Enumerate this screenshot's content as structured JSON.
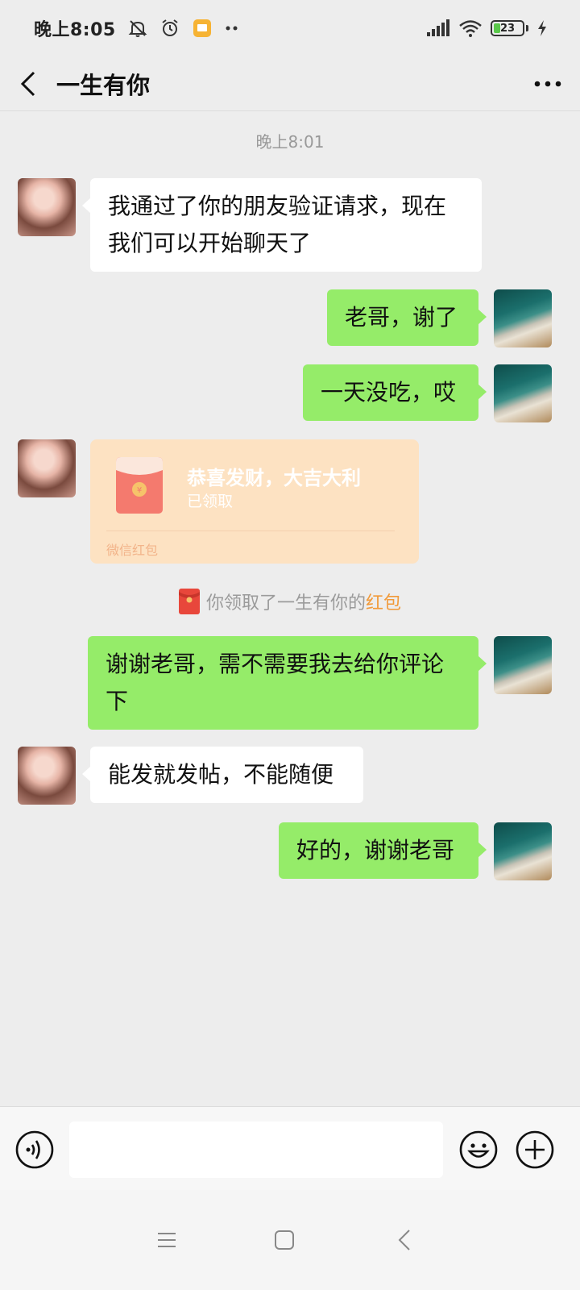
{
  "status_bar": {
    "time": "晚上8:05",
    "battery_level": "23",
    "battery_fraction": 0.23
  },
  "header": {
    "title": "一生有你",
    "back_icon": "back-arrow-icon",
    "more_icon": "more-dots-icon"
  },
  "timestamp": "晚上8:01",
  "messages": [
    {
      "side": "left",
      "text_line1": "我通过了你的朋友验证请求，现在",
      "text_line2": "我们可以开始聊天了"
    },
    {
      "side": "right",
      "text": "老哥，谢了"
    },
    {
      "side": "right",
      "text": "一天没吃，哎"
    },
    {
      "side": "right",
      "text_line1": "谢谢老哥，需不需要我去给你评论",
      "text_line2": "下"
    },
    {
      "side": "left",
      "text": "能发就发帖，不能随便"
    },
    {
      "side": "right",
      "text": "好的，谢谢老哥"
    }
  ],
  "red_packet": {
    "title": "恭喜发财，大吉大利",
    "status": "已领取",
    "footer": "微信红包",
    "color": "#fde2c2"
  },
  "system_note": {
    "text": "你领取了一生有你的",
    "highlight": "红包",
    "highlight_color": "#f19a3a"
  },
  "input_bar": {
    "placeholder": "",
    "voice_icon": "voice-icon",
    "emoji_icon": "emoji-icon",
    "plus_icon": "plus-icon"
  },
  "nav_bar": {
    "menu_icon": "menu-icon",
    "home_icon": "home-icon",
    "back_icon": "back-icon"
  },
  "colors": {
    "background": "#ededed",
    "bubble_self": "#95ec69",
    "bubble_other": "#ffffff"
  }
}
